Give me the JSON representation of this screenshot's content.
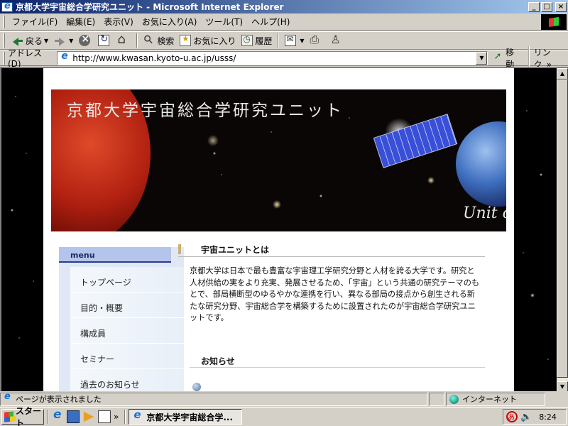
{
  "window": {
    "title": "京都大学宇宙総合学研究ユニット - Microsoft Internet Explorer",
    "controls": {
      "minimize": "_",
      "maximize": "□",
      "close": "×"
    }
  },
  "menubar": [
    "ファイル(F)",
    "編集(E)",
    "表示(V)",
    "お気に入り(A)",
    "ツール(T)",
    "ヘルプ(H)"
  ],
  "toolbar": {
    "back": "戻る",
    "search": "検索",
    "favorites": "お気に入り",
    "history": "履歴"
  },
  "address": {
    "label": "アドレス(D)",
    "url": "http://www.kwasan.kyoto-u.ac.jp/usss/",
    "go": "移動",
    "links": "リンク",
    "links_more": "»"
  },
  "page": {
    "banner_title": "京都大学宇宙総合学研究ユニット",
    "banner_subtitle": "Unit o",
    "menu_header": "menu",
    "menu_items": [
      "トップページ",
      "目的・概要",
      "構成員",
      "セミナー",
      "過去のお知らせ"
    ],
    "section1_title": "宇宙ユニットとは",
    "section1_text": "京都大学は日本で最も豊富な宇宙理工学研究分野と人材を誇る大学です。研究と人材供給の実をより充実、発展させるため、「宇宙」という共通の研究テーマのもとで、部局横断型のゆるやかな連携を行い、異なる部局の接点から創生される新たな研究分野、宇宙総合学を構築するために設置されたのが宇宙総合学研究ユニットです。",
    "section2_title": "お知らせ"
  },
  "statusbar": {
    "text": "ページが表示されました",
    "zone": "インターネット"
  },
  "taskbar": {
    "start": "スタート",
    "quicklaunch_more": "»",
    "active_task": "京都大学宇宙総合学...",
    "clock": "8:24"
  },
  "icons": {
    "back": "back-arrow-icon",
    "forward": "forward-arrow-icon",
    "stop": "stop-icon",
    "refresh": "refresh-icon",
    "home": "home-icon",
    "search": "search-icon",
    "favorites": "favorites-icon",
    "history": "history-icon",
    "mail": "mail-icon",
    "print": "print-icon",
    "messenger": "messenger-icon"
  },
  "colors": {
    "titlebar": "#0a246a",
    "menu_header_bg": "#b5c4ea",
    "menu_bg": "#dfe8f4",
    "section_bar": "#c8b078"
  }
}
